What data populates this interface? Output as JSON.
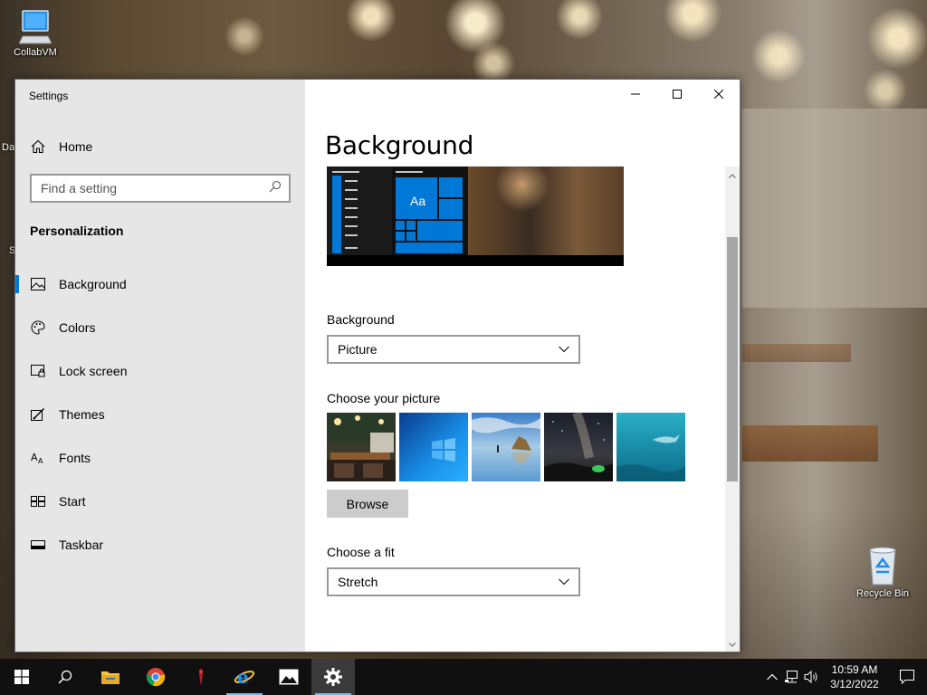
{
  "desktop": {
    "icons": {
      "collabvm": "CollabVM",
      "recycle_bin": "Recycle Bin"
    },
    "partial_labels": {
      "a": "Da",
      "b": "S"
    }
  },
  "window": {
    "title": "Settings",
    "controls": {
      "minimize": "minimize-icon",
      "maximize": "maximize-icon",
      "close": "close-icon"
    }
  },
  "sidebar": {
    "home_label": "Home",
    "search_placeholder": "Find a setting",
    "section_heading": "Personalization",
    "items": [
      {
        "label": "Background",
        "icon": "picture-icon",
        "selected": true
      },
      {
        "label": "Colors",
        "icon": "palette-icon",
        "selected": false
      },
      {
        "label": "Lock screen",
        "icon": "lock-screen-icon",
        "selected": false
      },
      {
        "label": "Themes",
        "icon": "themes-icon",
        "selected": false
      },
      {
        "label": "Fonts",
        "icon": "fonts-icon",
        "selected": false
      },
      {
        "label": "Start",
        "icon": "start-icon",
        "selected": false
      },
      {
        "label": "Taskbar",
        "icon": "taskbar-icon",
        "selected": false
      }
    ]
  },
  "main": {
    "title": "Background",
    "preview_tile_text": "Aa",
    "background_label": "Background",
    "background_value": "Picture",
    "choose_picture_label": "Choose your picture",
    "browse_label": "Browse",
    "fit_label": "Choose a fit",
    "fit_value": "Stretch"
  },
  "taskbar": {
    "apps": [
      "start-icon",
      "search-icon",
      "file-explorer-icon",
      "chrome-icon",
      "app-icon",
      "internet-explorer-icon",
      "photos-icon",
      "settings-icon"
    ],
    "clock_time": "10:59 AM",
    "clock_date": "3/12/2022"
  },
  "colors": {
    "accent": "#0078d7",
    "sidebar_bg": "#e6e6e6",
    "taskbar_bg": "#101010"
  }
}
